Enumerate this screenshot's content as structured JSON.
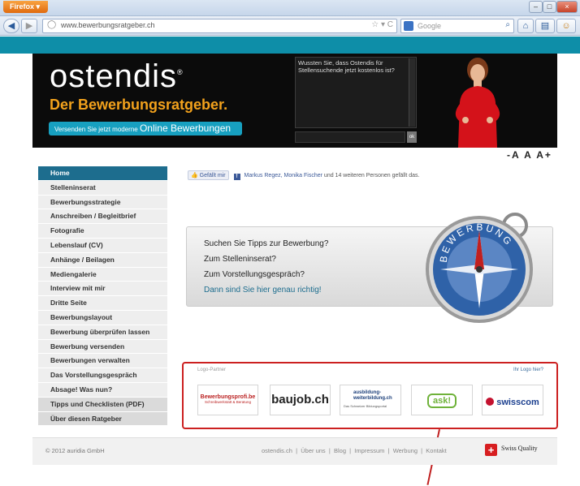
{
  "browser": {
    "app_button": "Firefox",
    "url": "www.bewerbungsratgeber.ch",
    "search_placeholder": "Google",
    "window_buttons": [
      "–",
      "□",
      "×"
    ]
  },
  "header": {
    "logo": "ostendis",
    "tagline": "Der Bewerbungsratgeber.",
    "cta_prefix": "Versenden Sie jetzt moderne",
    "cta_main": "Online Bewerbungen",
    "news_text": "Wussten Sie, dass Ostendis für Stellensuchende jetzt kostenlos ist?",
    "news_button": "ok",
    "font_sizer": "-A A A+"
  },
  "sidenav": {
    "items": [
      {
        "label": "Home",
        "state": "active"
      },
      {
        "label": "Stelleninserat",
        "state": ""
      },
      {
        "label": "Bewerbungsstrategie",
        "state": ""
      },
      {
        "label": "Anschreiben / Begleitbrief",
        "state": ""
      },
      {
        "label": "Fotografie",
        "state": ""
      },
      {
        "label": "Lebenslauf (CV)",
        "state": ""
      },
      {
        "label": "Anhänge / Beilagen",
        "state": ""
      },
      {
        "label": "Mediengalerie",
        "state": ""
      },
      {
        "label": "Interview mit mir",
        "state": ""
      },
      {
        "label": "Dritte Seite",
        "state": ""
      },
      {
        "label": "Bewerbungslayout",
        "state": ""
      },
      {
        "label": "Bewerbung überprüfen lassen",
        "state": ""
      },
      {
        "label": "Bewerbung versenden",
        "state": ""
      },
      {
        "label": "Bewerbungen verwalten",
        "state": ""
      },
      {
        "label": "Das Vorstellungsgespräch",
        "state": ""
      },
      {
        "label": "Absage! Was nun?",
        "state": ""
      },
      {
        "label": "Tipps und Checklisten (PDF)",
        "state": "dim"
      },
      {
        "label": "Über diesen Ratgeber",
        "state": "dim"
      }
    ]
  },
  "facebook": {
    "like_button": "Gefällt mir",
    "names": "Markus Regez, Monika Fischer",
    "rest": "und 14 weiteren Personen gefällt das."
  },
  "promo": {
    "q1": "Suchen Sie Tipps zur Bewerbung?",
    "q2": "Zum Stelleninserat?",
    "q3": "Zum Vorstellungsgespräch?",
    "answer": "Dann sind Sie hier genau richtig!",
    "compass_text": "BEWERBUNG"
  },
  "partners": {
    "label": "Logo-Partner",
    "link": "Ihr Logo hier?",
    "logos": [
      {
        "name": "Bewerbungsprofi.be",
        "sub": "Schreibwerkstatt & Beratung"
      },
      {
        "name": "baujob.ch"
      },
      {
        "name": "ausbildung-weiterbildung.ch",
        "sub": "Das Schweizer Bildungsportal"
      },
      {
        "name": "ask!"
      },
      {
        "name": "swisscom"
      }
    ]
  },
  "footer": {
    "copyright": "© 2012 auridia GmbH",
    "links": [
      "ostendis.ch",
      "Über uns",
      "Blog",
      "Impressum",
      "Werbung",
      "Kontakt"
    ],
    "quality": "Swiss Quality"
  }
}
